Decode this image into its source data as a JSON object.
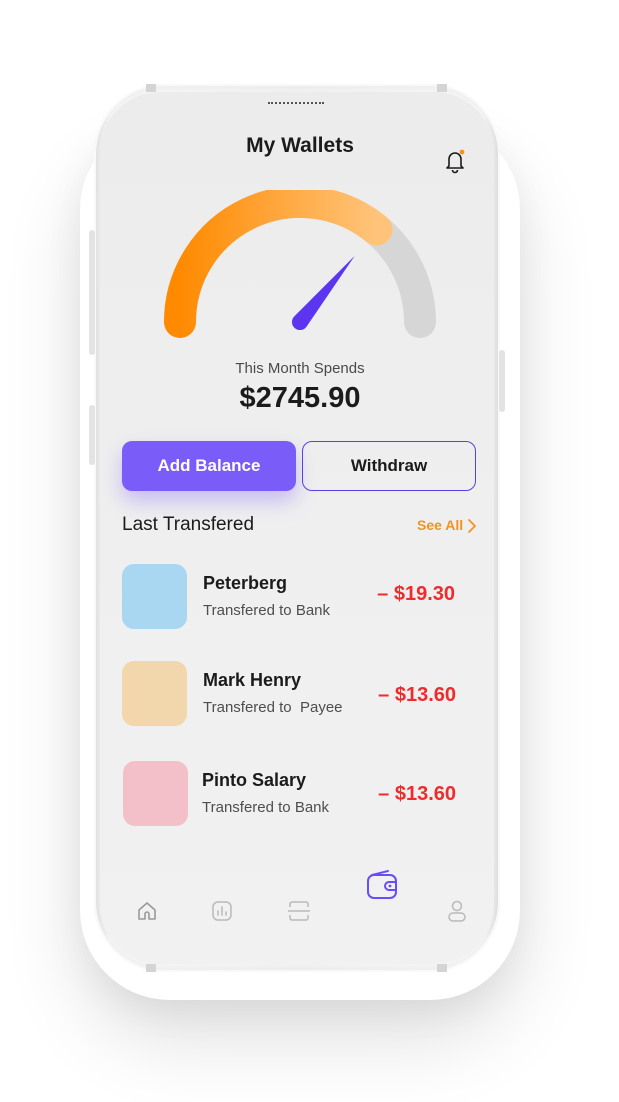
{
  "header": {
    "title": "My Wallets",
    "notification_icon": "bell-icon",
    "notification_dot_color": "#f5921e"
  },
  "gauge": {
    "level": 0.72,
    "fill_gradient": [
      "#ff8a00",
      "#ffc47a"
    ],
    "track_color": "#d6d6d6",
    "needle_color": "#5b35f0"
  },
  "summary": {
    "label": "This Month Spends",
    "amount": "$2745.90"
  },
  "actions": {
    "add_balance": "Add Balance",
    "withdraw": "Withdraw",
    "accent": "#7a5cf8"
  },
  "transfers": {
    "title": "Last Transfered",
    "see_all": "See All",
    "items": [
      {
        "name": "Peterberg",
        "subtitle": "Transfered to Bank",
        "amount": "– $19.30",
        "color": "#a9d6f0"
      },
      {
        "name": "Mark Henry",
        "subtitle": "Transfered to  Payee",
        "amount": "– $13.60",
        "color": "#f2d7ad"
      },
      {
        "name": "Pinto Salary",
        "subtitle": "Transfered to Bank",
        "amount": "– $13.60",
        "color": "#f3bfc8"
      }
    ]
  },
  "nav": {
    "items": [
      {
        "icon": "home-icon",
        "active": false
      },
      {
        "icon": "chart-icon",
        "active": false
      },
      {
        "icon": "scan-icon",
        "active": false
      },
      {
        "icon": "wallet-icon",
        "active": true
      },
      {
        "icon": "profile-icon",
        "active": false
      }
    ]
  }
}
